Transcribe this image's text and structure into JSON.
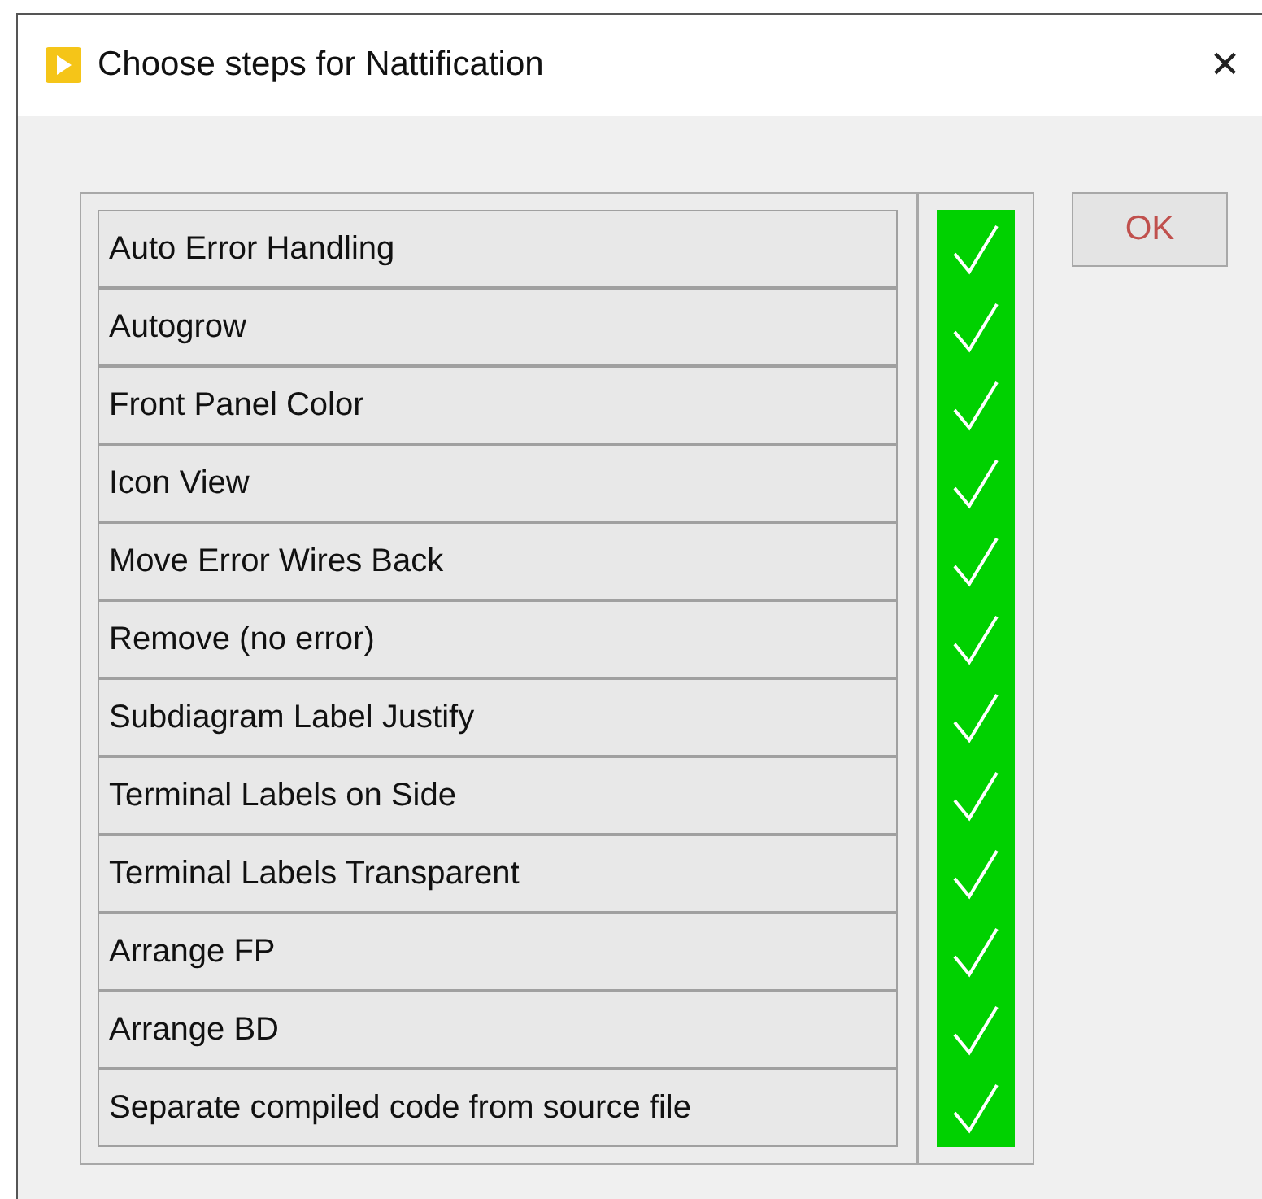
{
  "window": {
    "title": "Choose steps for Nattification",
    "close": "×"
  },
  "steps": [
    {
      "label": "Auto Error Handling",
      "checked": true
    },
    {
      "label": "Autogrow",
      "checked": true
    },
    {
      "label": "Front Panel Color",
      "checked": true
    },
    {
      "label": "Icon View",
      "checked": true
    },
    {
      "label": "Move Error Wires Back",
      "checked": true
    },
    {
      "label": "Remove (no error)",
      "checked": true
    },
    {
      "label": "Subdiagram Label Justify",
      "checked": true
    },
    {
      "label": "Terminal Labels on Side",
      "checked": true
    },
    {
      "label": "Terminal Labels Transparent",
      "checked": true
    },
    {
      "label": "Arrange FP",
      "checked": true
    },
    {
      "label": "Arrange BD",
      "checked": true
    },
    {
      "label": "Separate compiled code from source file",
      "checked": true
    }
  ],
  "ok_button": "OK"
}
